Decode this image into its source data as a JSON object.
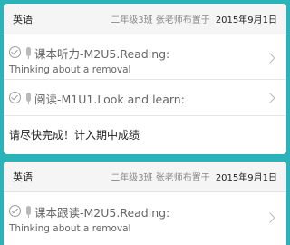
{
  "cards": [
    {
      "subject": "英语",
      "meta": "二年级3班 张老师布置于",
      "date": "2015年9月1日",
      "tasks": [
        {
          "title": "课本听力-M2U5.Reading:",
          "subtitle": "Thinking about a removal"
        },
        {
          "title": "阅读-M1U1.Look and learn:",
          "subtitle": ""
        }
      ],
      "note": "请尽快完成！计入期中成绩"
    },
    {
      "subject": "英语",
      "meta": "二年级3班 张老师布置于",
      "date": "2015年9月1日",
      "tasks": [
        {
          "title": "课本跟读-M2U5.Reading:",
          "subtitle": "Thinking about a removal"
        }
      ]
    }
  ]
}
